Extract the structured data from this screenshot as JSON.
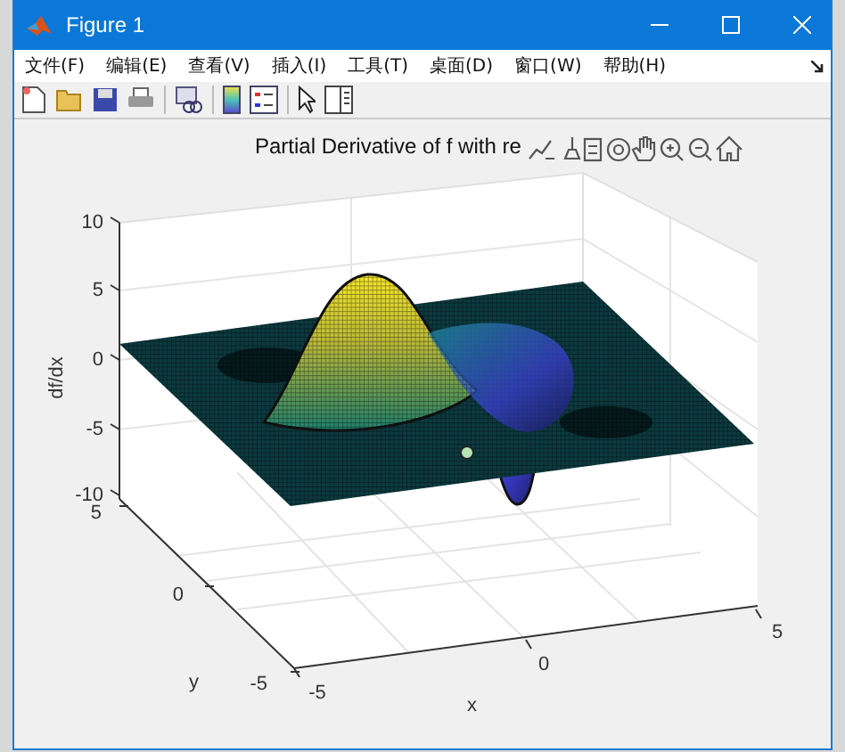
{
  "window": {
    "title": "Figure 1"
  },
  "menu": [
    "文件(F)",
    "编辑(E)",
    "查看(V)",
    "插入(I)",
    "工具(T)",
    "桌面(D)",
    "窗口(W)",
    "帮助(H)"
  ],
  "plot": {
    "title": "Partial Derivative of f with re",
    "zlabel": "df/dx",
    "ylabel": "y",
    "xlabel": "x",
    "zticks": [
      "10",
      "5",
      "0",
      "-5",
      "-10"
    ],
    "yticks": [
      "5",
      "0",
      "-5"
    ],
    "xticks": [
      "-5",
      "0",
      "5"
    ]
  }
}
